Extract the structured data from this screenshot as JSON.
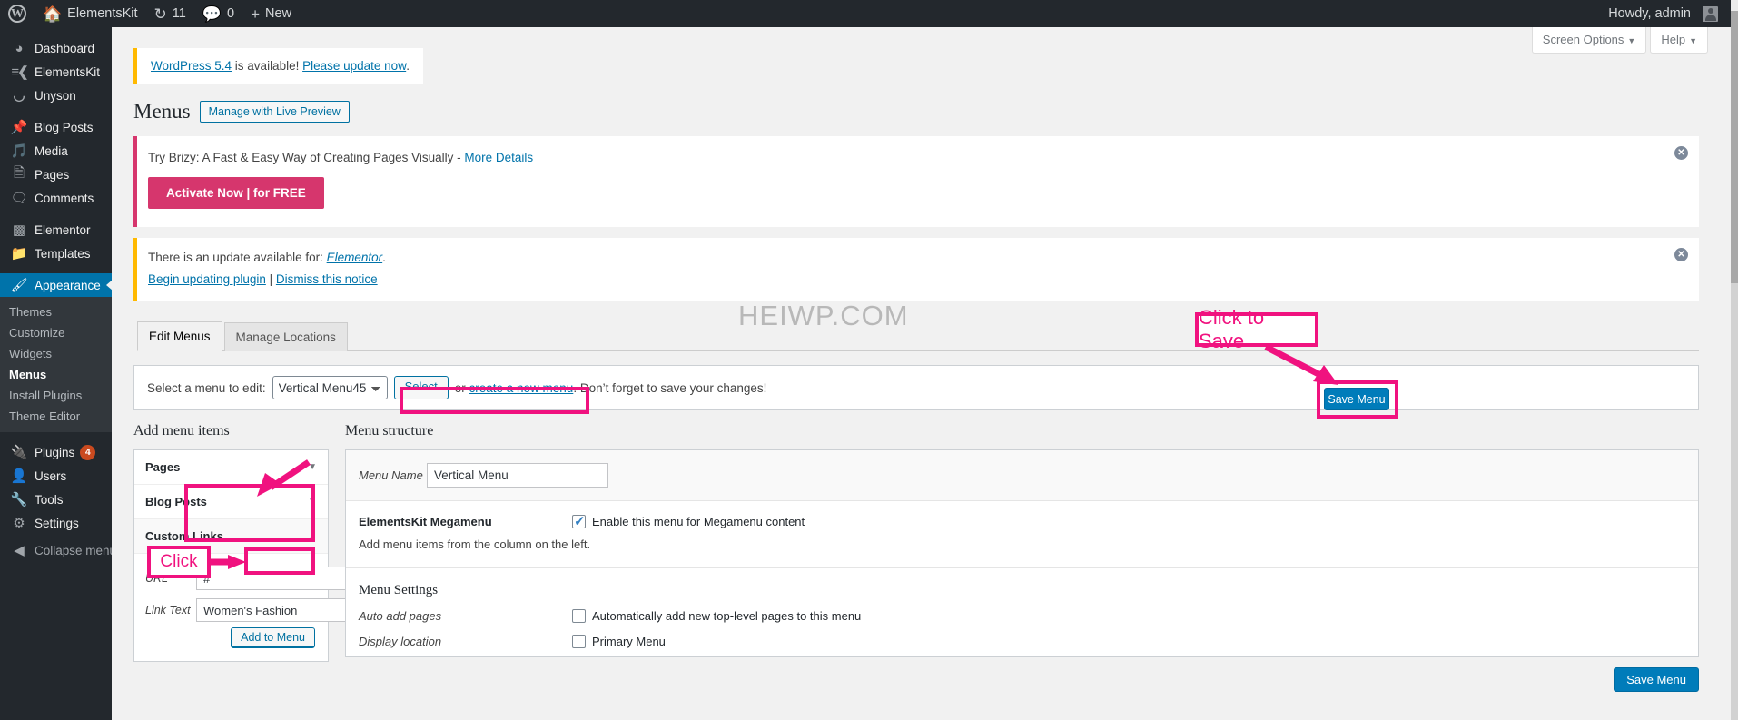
{
  "adminbar": {
    "logo_icon": "wordpress-logo-icon",
    "site_name": "ElementsKit",
    "site_icon": "home-icon",
    "updates_icon": "updates-icon",
    "updates_count": "11",
    "comments_icon": "comment-bubble-icon",
    "comments_count": "0",
    "new_icon": "plus-icon",
    "new_label": "New",
    "howdy": "Howdy, admin"
  },
  "sidebar": {
    "items": [
      {
        "label": "Dashboard",
        "icon": "dashboard-icon",
        "glyph": "◔"
      },
      {
        "label": "ElementsKit",
        "icon": "elementskit-icon",
        "glyph": "≡"
      },
      {
        "label": "Unyson",
        "icon": "unyson-icon",
        "glyph": "Ƶ"
      },
      {
        "label": "Blog Posts",
        "icon": "pin-icon",
        "glyph": "✐"
      },
      {
        "label": "Media",
        "icon": "media-icon",
        "glyph": "♫"
      },
      {
        "label": "Pages",
        "icon": "pages-icon",
        "glyph": "▤"
      },
      {
        "label": "Comments",
        "icon": "comment-icon",
        "glyph": "▭"
      },
      {
        "label": "Elementor",
        "icon": "elementor-icon",
        "glyph": "▥"
      },
      {
        "label": "Templates",
        "icon": "folder-icon",
        "glyph": "▱"
      }
    ],
    "appearance": {
      "label": "Appearance",
      "icon": "brush-icon",
      "glyph": "✎"
    },
    "appearance_sub": [
      {
        "label": "Themes"
      },
      {
        "label": "Customize"
      },
      {
        "label": "Widgets"
      },
      {
        "label": "Menus"
      },
      {
        "label": "Install Plugins"
      },
      {
        "label": "Theme Editor"
      }
    ],
    "tail": [
      {
        "label": "Plugins",
        "icon": "plug-icon",
        "glyph": "⚡",
        "badge": "4"
      },
      {
        "label": "Users",
        "icon": "user-icon",
        "glyph": "●",
        "badge": ""
      },
      {
        "label": "Tools",
        "icon": "wrench-icon",
        "glyph": "⚒",
        "badge": ""
      },
      {
        "label": "Settings",
        "icon": "sliders-icon",
        "glyph": "⚙",
        "badge": ""
      }
    ],
    "collapse": {
      "label": "Collapse menu",
      "icon": "collapse-arrow-icon",
      "glyph": "◀"
    }
  },
  "screen_meta": {
    "screen_options": "Screen Options",
    "help": "Help",
    "caret": "▼"
  },
  "notices": {
    "wp_update": {
      "link1": "WordPress 5.4",
      "mid": " is available! ",
      "link2": "Please update now",
      "tail": "."
    },
    "brizy": {
      "text": "Try Brizy: A Fast & Easy Way of Creating Pages Visually - ",
      "link": "More Details",
      "button": "Activate Now | for FREE",
      "dismiss_icon": "dismiss-x-icon"
    },
    "elementor": {
      "line1_pre": "There is an update available for: ",
      "line1_link": "Elementor",
      "line1_post": ".",
      "link_update": "Begin updating plugin",
      "sep": " | ",
      "link_dismiss": "Dismiss this notice",
      "dismiss_icon": "dismiss-x-icon"
    }
  },
  "page": {
    "title": "Menus",
    "title_action": "Manage with Live Preview",
    "watermark": "HEIWP.COM"
  },
  "tabs": [
    {
      "label": "Edit Menus",
      "active": true
    },
    {
      "label": "Manage Locations",
      "active": false
    }
  ],
  "menu_select": {
    "label": "Select a menu to edit:",
    "selected": "Vertical Menu45",
    "options": [
      "Vertical Menu45"
    ],
    "select_button": "Select",
    "or": "or ",
    "create_link": "create a new menu",
    "tail": ". Don’t forget to save your changes!"
  },
  "add_menu_items": {
    "heading": "Add menu items",
    "panels": [
      {
        "label": "Pages",
        "chev": "▼"
      },
      {
        "label": "Blog Posts",
        "chev": "▼"
      },
      {
        "label": "Custom Links",
        "chev": "▲"
      }
    ],
    "custom_links": {
      "url_label": "URL",
      "url_value": "#",
      "text_label": "Link Text",
      "text_value": "Women's Fashion",
      "add_button": "Add to Menu"
    }
  },
  "menu_structure": {
    "heading": "Menu structure",
    "name_label": "Menu Name",
    "name_value": "Vertical Menu",
    "megamenu_label": "ElementsKit Megamenu",
    "megamenu_checkbox": "Enable this menu for Megamenu content",
    "megamenu_checked": true,
    "hint": "Add menu items from the column on the left.",
    "settings_heading": "Menu Settings",
    "auto_add_label": "Auto add pages",
    "auto_add_checkbox": "Automatically add new top-level pages to this menu",
    "auto_add_checked": false,
    "display_label": "Display location",
    "display_checkbox": "Primary Menu",
    "display_checked": false,
    "save_button": "Save Menu"
  },
  "annotations": {
    "click_to_save": "Click to Save",
    "click": "Click",
    "accent": "#f0127f"
  }
}
